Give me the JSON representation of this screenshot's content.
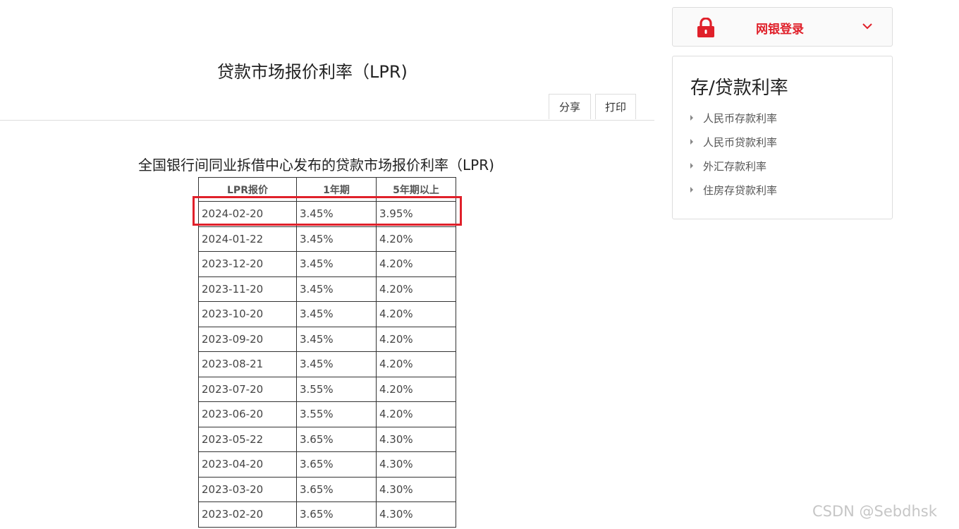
{
  "header": {
    "title": "贷款市场报价利率（LPR)",
    "share_label": "分享",
    "print_label": "打印"
  },
  "table": {
    "heading": "全国银行间同业拆借中心发布的贷款市场报价利率（LPR)",
    "columns": [
      "LPR报价",
      "1年期",
      "5年期以上"
    ],
    "rows": [
      [
        "2024-02-20",
        "3.45%",
        "3.95%"
      ],
      [
        "2024-01-22",
        "3.45%",
        "4.20%"
      ],
      [
        "2023-12-20",
        "3.45%",
        "4.20%"
      ],
      [
        "2023-11-20",
        "3.45%",
        "4.20%"
      ],
      [
        "2023-10-20",
        "3.45%",
        "4.20%"
      ],
      [
        "2023-09-20",
        "3.45%",
        "4.20%"
      ],
      [
        "2023-08-21",
        "3.45%",
        "4.20%"
      ],
      [
        "2023-07-20",
        "3.55%",
        "4.20%"
      ],
      [
        "2023-06-20",
        "3.55%",
        "4.20%"
      ],
      [
        "2023-05-22",
        "3.65%",
        "4.30%"
      ],
      [
        "2023-04-20",
        "3.65%",
        "4.30%"
      ],
      [
        "2023-03-20",
        "3.65%",
        "4.30%"
      ],
      [
        "2023-02-20",
        "3.65%",
        "4.30%"
      ]
    ]
  },
  "sidebar": {
    "login_label": "网银登录",
    "rates_title": "存/贷款利率",
    "rates_links": [
      "人民币存款利率",
      "人民币贷款利率",
      "外汇存款利率",
      "住房存贷款利率"
    ]
  },
  "watermark": "CSDN @Sebdhsk",
  "colors": {
    "accent_red": "#e0202a"
  },
  "icons": {
    "login": "lock-icon",
    "login_toggle": "chevron-down-icon",
    "link_bullet": "triangle-right-icon"
  }
}
